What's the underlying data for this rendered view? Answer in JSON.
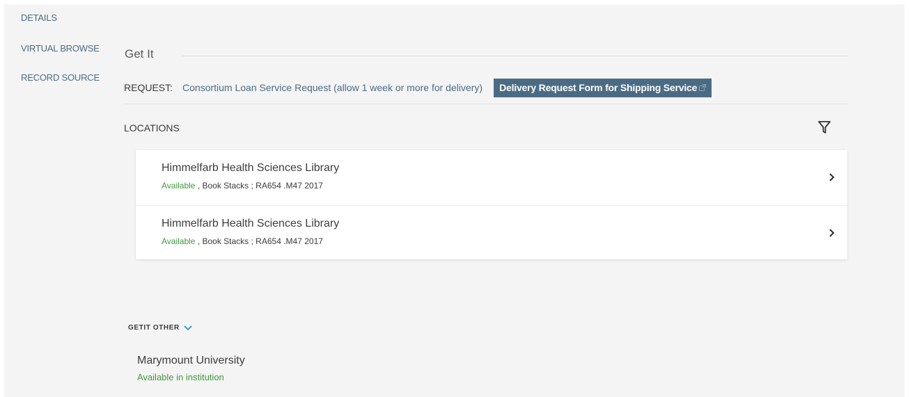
{
  "side_nav": {
    "details": "DETAILS",
    "virtual_browse": "VIRTUAL BROWSE",
    "record_source": "RECORD SOURCE"
  },
  "get_it": {
    "title": "Get It",
    "request_label": "REQUEST:",
    "consortium_link": "Consortium Loan Service Request (allow 1 week or more for delivery)",
    "delivery_button": "Delivery Request Form for Shipping Service",
    "locations_label": "LOCATIONS",
    "locations": [
      {
        "name": "Himmelfarb Health Sciences Library",
        "status": "Available",
        "detail": " , Book Stacks ; RA654 .M47 2017"
      },
      {
        "name": "Himmelfarb Health Sciences Library",
        "status": "Available",
        "detail": " , Book Stacks ; RA654 .M47 2017"
      }
    ]
  },
  "getit_other": {
    "label": "GETIT OTHER",
    "institution": "Marymount University",
    "status": "Available in institution"
  },
  "icons": {
    "filter": "filter-icon",
    "chevron_right": "chevron-right-icon",
    "chevron_down": "chevron-down-icon",
    "external_link": "external-link-icon"
  },
  "colors": {
    "link": "#4a6b86",
    "button_bg": "#4b6b84",
    "available": "#3e9a3c",
    "chevron_down": "#3a9fc4"
  }
}
